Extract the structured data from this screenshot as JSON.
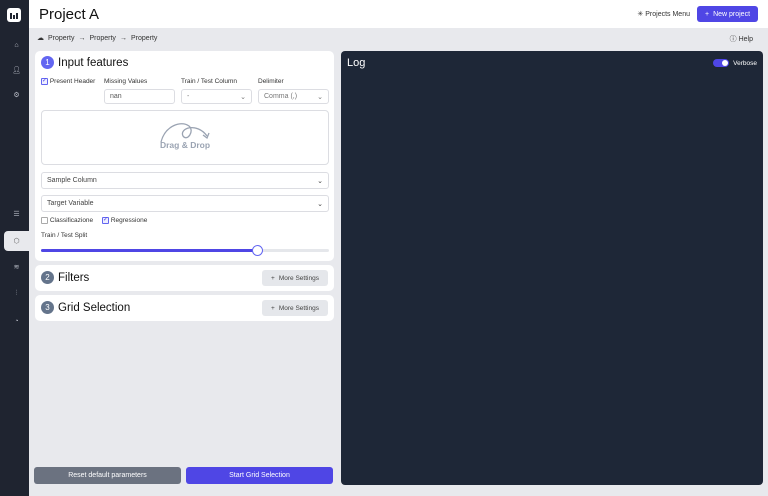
{
  "header": {
    "title": "Project A",
    "projects_menu": "Projects Menu",
    "new_project": "New project"
  },
  "breadcrumb": [
    "Property",
    "Property",
    "Property"
  ],
  "help": "Help",
  "input_features": {
    "number": "1",
    "title": "Input features",
    "present_header": "Present Header",
    "present_header_checked": true,
    "missing_values_label": "Missing Values",
    "missing_values": "nan",
    "train_test_column_label": "Train / Test Column",
    "train_test_column": "-",
    "delimiter_label": "Delimiter",
    "delimiter": "Comma (,)",
    "drag_drop": "Drag & Drop",
    "sample_column": "Sample Column",
    "target_variable": "Target Variable",
    "classificazione": "Classificazione",
    "classificazione_checked": false,
    "regressione": "Regressione",
    "regressione_checked": true,
    "split_label": "Train / Test Split",
    "split_fraction": 0.75
  },
  "filters": {
    "number": "2",
    "title": "Filters",
    "more": "More Settings"
  },
  "grid_selection": {
    "number": "3",
    "title": "Grid Selection",
    "more": "More Settings"
  },
  "log": {
    "title": "Log",
    "verbose": "Verbose",
    "verbose_on": true
  },
  "footer": {
    "reset": "Reset default parameters",
    "start": "Start Grid Selection"
  },
  "colors": {
    "accent": "#4f46e5",
    "sidebar": "#1f2430",
    "log_bg": "#1e2737"
  }
}
